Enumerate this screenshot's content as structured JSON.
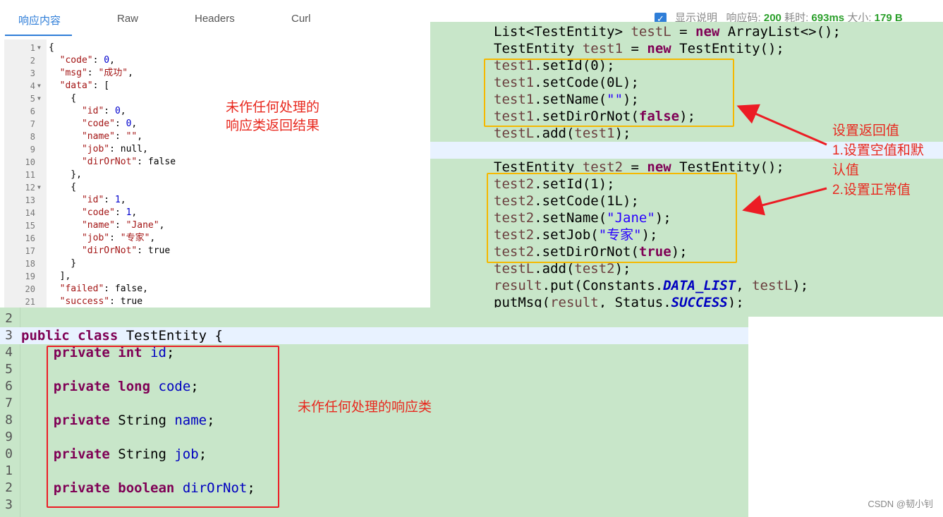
{
  "tabs": [
    "响应内容",
    "Raw",
    "Headers",
    "Curl"
  ],
  "status": {
    "checkbox_label": "显示说明",
    "code_label": "响应码:",
    "code": "200",
    "time_label": "耗时:",
    "time": "693ms",
    "size_label": "大小:",
    "size": "179 B"
  },
  "json_lines": [
    {
      "n": "1",
      "fold": true,
      "parts": [
        [
          "p",
          "{"
        ]
      ]
    },
    {
      "n": "2",
      "parts": [
        [
          "p",
          "  "
        ],
        [
          "k",
          "\"code\""
        ],
        [
          "p",
          ": "
        ],
        [
          "n",
          "0"
        ],
        [
          "p",
          ","
        ]
      ]
    },
    {
      "n": "3",
      "parts": [
        [
          "p",
          "  "
        ],
        [
          "k",
          "\"msg\""
        ],
        [
          "p",
          ": "
        ],
        [
          "s",
          "\"成功\""
        ],
        [
          "p",
          ","
        ]
      ]
    },
    {
      "n": "4",
      "fold": true,
      "parts": [
        [
          "p",
          "  "
        ],
        [
          "k",
          "\"data\""
        ],
        [
          "p",
          ": ["
        ]
      ]
    },
    {
      "n": "5",
      "fold": true,
      "parts": [
        [
          "p",
          "    {"
        ]
      ]
    },
    {
      "n": "6",
      "parts": [
        [
          "p",
          "      "
        ],
        [
          "k",
          "\"id\""
        ],
        [
          "p",
          ": "
        ],
        [
          "n",
          "0"
        ],
        [
          "p",
          ","
        ]
      ]
    },
    {
      "n": "7",
      "parts": [
        [
          "p",
          "      "
        ],
        [
          "k",
          "\"code\""
        ],
        [
          "p",
          ": "
        ],
        [
          "n",
          "0"
        ],
        [
          "p",
          ","
        ]
      ]
    },
    {
      "n": "8",
      "parts": [
        [
          "p",
          "      "
        ],
        [
          "k",
          "\"name\""
        ],
        [
          "p",
          ": "
        ],
        [
          "s",
          "\"\""
        ],
        [
          "p",
          ","
        ]
      ]
    },
    {
      "n": "9",
      "parts": [
        [
          "p",
          "      "
        ],
        [
          "k",
          "\"job\""
        ],
        [
          "p",
          ": null,"
        ]
      ]
    },
    {
      "n": "10",
      "parts": [
        [
          "p",
          "      "
        ],
        [
          "k",
          "\"dirOrNot\""
        ],
        [
          "p",
          ": false"
        ]
      ]
    },
    {
      "n": "11",
      "parts": [
        [
          "p",
          "    },"
        ]
      ]
    },
    {
      "n": "12",
      "fold": true,
      "parts": [
        [
          "p",
          "    {"
        ]
      ]
    },
    {
      "n": "13",
      "parts": [
        [
          "p",
          "      "
        ],
        [
          "k",
          "\"id\""
        ],
        [
          "p",
          ": "
        ],
        [
          "n",
          "1"
        ],
        [
          "p",
          ","
        ]
      ]
    },
    {
      "n": "14",
      "parts": [
        [
          "p",
          "      "
        ],
        [
          "k",
          "\"code\""
        ],
        [
          "p",
          ": "
        ],
        [
          "n",
          "1"
        ],
        [
          "p",
          ","
        ]
      ]
    },
    {
      "n": "15",
      "parts": [
        [
          "p",
          "      "
        ],
        [
          "k",
          "\"name\""
        ],
        [
          "p",
          ": "
        ],
        [
          "s",
          "\"Jane\""
        ],
        [
          "p",
          ","
        ]
      ]
    },
    {
      "n": "16",
      "parts": [
        [
          "p",
          "      "
        ],
        [
          "k",
          "\"job\""
        ],
        [
          "p",
          ": "
        ],
        [
          "s",
          "\"专家\""
        ],
        [
          "p",
          ","
        ]
      ]
    },
    {
      "n": "17",
      "parts": [
        [
          "p",
          "      "
        ],
        [
          "k",
          "\"dirOrNot\""
        ],
        [
          "p",
          ": true"
        ]
      ]
    },
    {
      "n": "18",
      "parts": [
        [
          "p",
          "    }"
        ]
      ]
    },
    {
      "n": "19",
      "parts": [
        [
          "p",
          "  ],"
        ]
      ]
    },
    {
      "n": "20",
      "parts": [
        [
          "p",
          "  "
        ],
        [
          "k",
          "\"failed\""
        ],
        [
          "p",
          ": false,"
        ]
      ]
    },
    {
      "n": "21",
      "parts": [
        [
          "p",
          "  "
        ],
        [
          "k",
          "\"success\""
        ],
        [
          "p",
          ": true"
        ]
      ]
    }
  ],
  "note_json": "未作任何处理的\n响应类返回结果",
  "right_code": [
    [
      [
        "p",
        "List<TestEntity> "
      ],
      [
        "var",
        "testL"
      ],
      [
        "p",
        " = "
      ],
      [
        "kw",
        "new"
      ],
      [
        "p",
        " ArrayList<>();"
      ]
    ],
    [
      [
        "p",
        "TestEntity "
      ],
      [
        "var",
        "test1"
      ],
      [
        "p",
        " = "
      ],
      [
        "kw",
        "new"
      ],
      [
        "p",
        " TestEntity();"
      ]
    ],
    [
      [
        "var",
        "test1"
      ],
      [
        "p",
        ".setId(0);"
      ]
    ],
    [
      [
        "var",
        "test1"
      ],
      [
        "p",
        ".setCode(0L);"
      ]
    ],
    [
      [
        "var",
        "test1"
      ],
      [
        "p",
        ".setName("
      ],
      [
        "str",
        "\"\""
      ],
      [
        "p",
        ");"
      ]
    ],
    [
      [
        "var",
        "test1"
      ],
      [
        "p",
        ".setDirOrNot("
      ],
      [
        "kw",
        "false"
      ],
      [
        "p",
        ");"
      ]
    ],
    [
      [
        "var",
        "testL"
      ],
      [
        "p",
        ".add("
      ],
      [
        "var",
        "test1"
      ],
      [
        "p",
        ");"
      ]
    ],
    [],
    [
      [
        "p",
        "TestEntity "
      ],
      [
        "var",
        "test2"
      ],
      [
        "p",
        " = "
      ],
      [
        "kw",
        "new"
      ],
      [
        "p",
        " TestEntity();"
      ]
    ],
    [
      [
        "var",
        "test2"
      ],
      [
        "p",
        ".setId(1);"
      ]
    ],
    [
      [
        "var",
        "test2"
      ],
      [
        "p",
        ".setCode(1L);"
      ]
    ],
    [
      [
        "var",
        "test2"
      ],
      [
        "p",
        ".setName("
      ],
      [
        "str",
        "\"Jane\""
      ],
      [
        "p",
        ");"
      ]
    ],
    [
      [
        "var",
        "test2"
      ],
      [
        "p",
        ".setJob("
      ],
      [
        "str",
        "\"专家\""
      ],
      [
        "p",
        ");"
      ]
    ],
    [
      [
        "var",
        "test2"
      ],
      [
        "p",
        ".setDirOrNot("
      ],
      [
        "kw",
        "true"
      ],
      [
        "p",
        ");"
      ]
    ],
    [
      [
        "var",
        "testL"
      ],
      [
        "p",
        ".add("
      ],
      [
        "var",
        "test2"
      ],
      [
        "p",
        ");"
      ]
    ],
    [
      [
        "var",
        "result"
      ],
      [
        "p",
        ".put(Constants."
      ],
      [
        "fld",
        "DATA_LIST"
      ],
      [
        "p",
        ", "
      ],
      [
        "var",
        "testL"
      ],
      [
        "p",
        ");"
      ]
    ],
    [
      [
        "p",
        "putMsg("
      ],
      [
        "var",
        "result"
      ],
      [
        "p",
        ", Status."
      ],
      [
        "fld",
        "SUCCESS"
      ],
      [
        "p",
        ");"
      ]
    ]
  ],
  "annotation_right": "设置返回值\n1.设置空值和默\n认值\n2.设置正常值",
  "bottom_code": [
    {
      "n": "2",
      "parts": []
    },
    {
      "n": "3",
      "parts": [
        [
          "kw",
          "public class"
        ],
        [
          "p",
          " TestEntity {"
        ]
      ]
    },
    {
      "n": "4",
      "parts": [
        [
          "p",
          "    "
        ],
        [
          "kw",
          "private int"
        ],
        [
          "p",
          " "
        ],
        [
          "fld2",
          "id"
        ],
        [
          "p",
          ";"
        ]
      ]
    },
    {
      "n": "5",
      "parts": []
    },
    {
      "n": "6",
      "parts": [
        [
          "p",
          "    "
        ],
        [
          "kw",
          "private long"
        ],
        [
          "p",
          " "
        ],
        [
          "fld2",
          "code"
        ],
        [
          "p",
          ";"
        ]
      ]
    },
    {
      "n": "7",
      "parts": []
    },
    {
      "n": "8",
      "parts": [
        [
          "p",
          "    "
        ],
        [
          "kw",
          "private"
        ],
        [
          "p",
          " String "
        ],
        [
          "fld2",
          "name"
        ],
        [
          "p",
          ";"
        ]
      ]
    },
    {
      "n": "9",
      "parts": []
    },
    {
      "n": "0",
      "parts": [
        [
          "p",
          "    "
        ],
        [
          "kw",
          "private"
        ],
        [
          "p",
          " String "
        ],
        [
          "fld2",
          "job"
        ],
        [
          "p",
          ";"
        ]
      ]
    },
    {
      "n": "1",
      "parts": []
    },
    {
      "n": "2",
      "parts": [
        [
          "p",
          "    "
        ],
        [
          "kw",
          "private boolean"
        ],
        [
          "p",
          " "
        ],
        [
          "fld2",
          "dirOrNot"
        ],
        [
          "p",
          ";"
        ]
      ]
    },
    {
      "n": "3",
      "parts": []
    }
  ],
  "note_class": "未作任何处理的响应类",
  "watermark": "CSDN @韧小钊",
  "colors": {
    "accent": "#2f7ed8",
    "code_bg": "#c8e6c9",
    "annotation_red": "#e8281e",
    "box_yellow": "#f5b800",
    "box_red": "#ec1c24"
  }
}
